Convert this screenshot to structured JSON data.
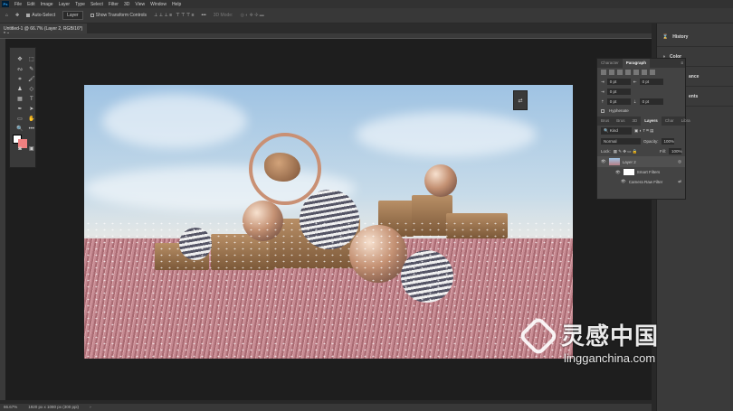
{
  "menu": [
    "File",
    "Edit",
    "Image",
    "Layer",
    "Type",
    "Select",
    "Filter",
    "3D",
    "View",
    "Window",
    "Help"
  ],
  "options": {
    "auto_select": "Auto-Select",
    "layer_select": "Layer",
    "transform": "Show Transform Controls",
    "mode_3d": "3D Mode:"
  },
  "document_tab": "Untitled-1 @ 66.7% (Layer 2, RGB/16*) *",
  "dock": [
    {
      "icon": "history-icon",
      "label": "History"
    },
    {
      "icon": "color-icon",
      "label": "Color"
    },
    {
      "icon": "panel-icon",
      "label": "ance"
    },
    {
      "icon": "panel-icon",
      "label": "ents"
    }
  ],
  "paragraph_panel": {
    "tabs": [
      "Character",
      "Paragraph"
    ],
    "active": "Paragraph",
    "fields": [
      "0 pt",
      "0 pt",
      "0 pt",
      "0 pt",
      "0 pt"
    ],
    "hyphenate": "Hyphenate"
  },
  "layers_panel": {
    "tabs": [
      "Brus",
      "Brus",
      "3D",
      "Layers",
      "Char",
      "Libra"
    ],
    "active": "Layers",
    "filter": "Kind",
    "blend": "Normal",
    "opacity_label": "Opacity:",
    "opacity": "100%",
    "lock_label": "Lock:",
    "fill_label": "Fill:",
    "fill": "100%",
    "layers": [
      {
        "name": "Layer 2"
      },
      {
        "name": "Smart Filters"
      },
      {
        "name": "Camera Raw Filter"
      }
    ]
  },
  "status": {
    "zoom": "66.67%",
    "doc_info": "1920 px x 1080 px (300 ppi)"
  },
  "watermark": {
    "zh": "灵感中国",
    "en": "lingganchina.com"
  },
  "colors": {
    "foreground": "#ffffff",
    "background": "#f08080",
    "accent": "#31a8ff"
  }
}
